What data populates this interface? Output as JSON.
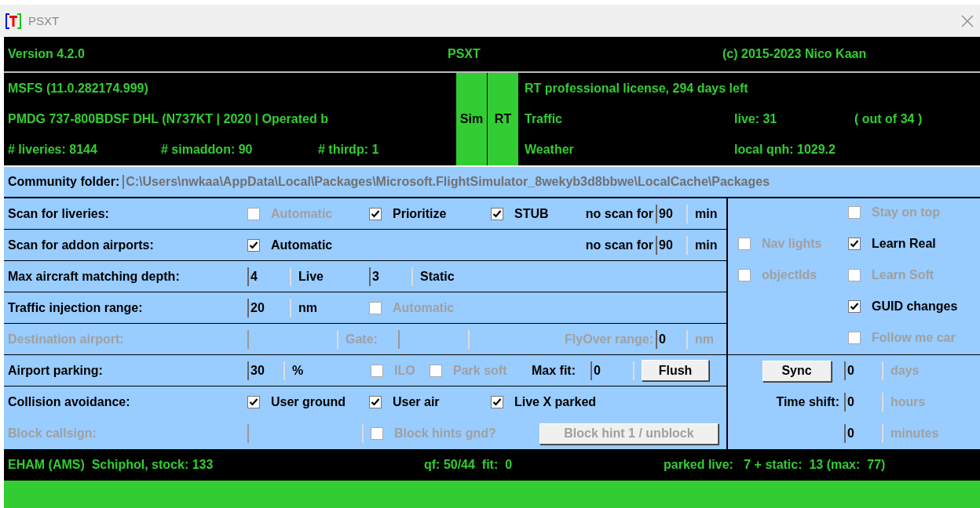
{
  "window": {
    "title": "PSXT"
  },
  "header": {
    "version": "Version 4.2.0",
    "title": "PSXT",
    "copyright": "(c) 2015-2023 Nico Kaan"
  },
  "info": {
    "sim_lines": [
      "MSFS (11.0.282174.999)",
      "PMDG 737-800BDSF DHL (N737KT | 2020 | Operated b"
    ],
    "counts": [
      "# liveries: 8144",
      "# simaddon: 90",
      "# thirdp: 1"
    ],
    "indicators": [
      {
        "label": "Sim",
        "on": true
      },
      {
        "label": "RT",
        "on": true
      }
    ],
    "license": "RT professional license, 294 days left",
    "rows": [
      {
        "label": "Traffic",
        "value": "live: 31",
        "extra": "( out of 34 )"
      },
      {
        "label": "Weather",
        "value": "local qnh: 1029.2"
      }
    ]
  },
  "community_folder": {
    "label": "Community folder:",
    "value": "C:\\Users\\nwkaa\\AppData\\Local\\Packages\\Microsoft.FlightSimulator_8wekyb3d8bbwe\\LocalCache\\Packages"
  },
  "settings": {
    "rows": [
      {
        "label": "Scan for liveries:",
        "disabled": false,
        "items": [
          {
            "kind": "checkbox",
            "label": "Automatic",
            "checked": false,
            "disabled": true
          },
          {
            "kind": "checkbox",
            "label": "Prioritize",
            "checked": true,
            "disabled": false
          },
          {
            "kind": "checkbox",
            "label": "STUB",
            "checked": true,
            "disabled": false
          },
          {
            "kind": "text",
            "text": "no scan for",
            "disabled": false
          },
          {
            "kind": "field",
            "value": "90",
            "disabled": false
          },
          {
            "kind": "text",
            "text": "min",
            "disabled": false
          }
        ]
      },
      {
        "label": "Scan for addon airports:",
        "disabled": false,
        "items": [
          {
            "kind": "checkbox",
            "label": "Automatic",
            "checked": true,
            "disabled": false
          },
          {
            "kind": "text",
            "text": "no scan for",
            "disabled": false
          },
          {
            "kind": "field",
            "value": "90",
            "disabled": false
          },
          {
            "kind": "text",
            "text": "min",
            "disabled": false
          }
        ]
      },
      {
        "label": "Max aircraft matching depth:",
        "disabled": false,
        "items": [
          {
            "kind": "field",
            "value": "4",
            "disabled": false
          },
          {
            "kind": "text",
            "text": "Live",
            "disabled": false
          },
          {
            "kind": "field",
            "value": "3",
            "disabled": false
          },
          {
            "kind": "text",
            "text": "Static",
            "disabled": false
          }
        ]
      },
      {
        "label": "Traffic injection range:",
        "disabled": false,
        "items": [
          {
            "kind": "field",
            "value": "20",
            "disabled": false
          },
          {
            "kind": "text",
            "text": "nm",
            "disabled": false
          },
          {
            "kind": "checkbox",
            "label": "Automatic",
            "checked": false,
            "disabled": true
          }
        ]
      },
      {
        "label": "Destination airport:",
        "disabled": true,
        "items": [
          {
            "kind": "field",
            "disabled": true
          },
          {
            "kind": "text",
            "text": "Gate:",
            "disabled": true
          },
          {
            "kind": "field",
            "disabled": true
          },
          {
            "kind": "text",
            "text": "FlyOver range:",
            "disabled": true
          },
          {
            "kind": "field",
            "value": "0",
            "disabled": false
          },
          {
            "kind": "text",
            "text": "nm",
            "disabled": true
          }
        ]
      },
      {
        "label": "Airport parking:",
        "disabled": false,
        "items": [
          {
            "kind": "field",
            "value": "30",
            "disabled": false
          },
          {
            "kind": "text",
            "text": "%",
            "disabled": false
          },
          {
            "kind": "checkbox",
            "label": "ILO",
            "checked": false,
            "disabled": true
          },
          {
            "kind": "checkbox",
            "label": "Park soft",
            "checked": false,
            "disabled": true
          },
          {
            "kind": "text",
            "text": "Max fit:",
            "disabled": false
          },
          {
            "kind": "field",
            "value": "0",
            "disabled": false
          },
          {
            "kind": "button",
            "label": "Flush",
            "disabled": false
          }
        ]
      },
      {
        "label": "Collision avoidance:",
        "disabled": false,
        "items": [
          {
            "kind": "checkbox",
            "label": "User ground",
            "checked": true,
            "disabled": false
          },
          {
            "kind": "checkbox",
            "label": "User air",
            "checked": true,
            "disabled": false
          },
          {
            "kind": "checkbox",
            "label": "Live X parked",
            "checked": true,
            "disabled": false
          }
        ]
      },
      {
        "label": "Block callsign:",
        "disabled": true,
        "items": [
          {
            "kind": "field",
            "disabled": true
          },
          {
            "kind": "checkbox",
            "label": "Block hints gnd?",
            "checked": false,
            "disabled": true
          },
          {
            "kind": "button",
            "label": "Block hint 1 / unblock",
            "disabled": true
          }
        ]
      }
    ]
  },
  "options": {
    "rows": [
      {
        "right": {
          "label": "Stay on top",
          "checked": false,
          "disabled": true
        }
      },
      {
        "left": {
          "label": "Nav lights",
          "checked": false,
          "disabled": true
        },
        "right": {
          "label": "Learn Real",
          "checked": true,
          "disabled": false
        }
      },
      {
        "left": {
          "label": "objectIds",
          "checked": false,
          "disabled": true
        },
        "right": {
          "label": "Learn Soft",
          "checked": false,
          "disabled": true
        }
      },
      {
        "right": {
          "label": "GUID changes",
          "checked": true,
          "disabled": false
        }
      },
      {
        "right": {
          "label": "Follow me car",
          "checked": false,
          "disabled": true
        }
      }
    ]
  },
  "time_shift": {
    "rows": [
      {
        "lead": {
          "kind": "button",
          "label": "Sync"
        },
        "value": "0",
        "unit": "days",
        "unit_disabled": true
      },
      {
        "lead": {
          "kind": "text",
          "text": "Time shift:"
        },
        "value": "0",
        "unit": "hours",
        "unit_disabled": true
      },
      {
        "value": "0",
        "unit": "minutes",
        "unit_disabled": true
      }
    ]
  },
  "status_bar": [
    "EHAM (AMS)  Schiphol, stock: 133",
    "qf: 50/44  fit:  0",
    "parked live:   7 + static:  13 (max:  77)"
  ]
}
